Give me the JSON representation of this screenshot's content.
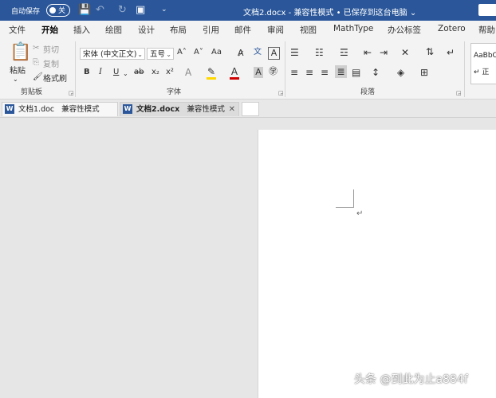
{
  "titlebar": {
    "autosave_label": "自动保存",
    "autosave_state": "关",
    "doc_title": "文档2.docx  -  兼容性模式 • 已保存到这台电脑 ⌄",
    "icons": [
      "save-icon",
      "undo-icon",
      "redo-icon",
      "customize-icon"
    ]
  },
  "menu_tabs": [
    "文件",
    "开始",
    "插入",
    "绘图",
    "设计",
    "布局",
    "引用",
    "邮件",
    "审阅",
    "视图",
    "MathType",
    "办公标签",
    "Zotero",
    "帮助"
  ],
  "active_menu_tab": "开始",
  "ribbon": {
    "clipboard": {
      "paste": "粘贴",
      "cut": "剪切",
      "copy": "复制",
      "format_painter": "格式刷",
      "label": "剪贴板"
    },
    "font": {
      "font_name": "宋体 (中文正文)",
      "font_size": "五号",
      "grow": "A˄",
      "shrink": "A˅",
      "change_case": "Aa",
      "bold": "B",
      "italic": "I",
      "underline": "U",
      "strike": "ab",
      "subscript": "x₂",
      "superscript": "x²",
      "label": "字体"
    },
    "paragraph": {
      "label": "段落"
    },
    "styles": {
      "sample1": "AaBbC",
      "sample2": "↵ 正"
    }
  },
  "doc_tabs": [
    {
      "name": "文档1.doc",
      "mode": "兼容性模式"
    },
    {
      "name": "文档2.docx",
      "mode": "兼容性模式"
    }
  ],
  "document": {
    "paragraph_mark": "↵"
  },
  "watermark": "头条 @到此为止a884f",
  "colors": {
    "title_blue": "#2b579a",
    "highlight": "#ffd800",
    "font_red": "#d00000"
  }
}
